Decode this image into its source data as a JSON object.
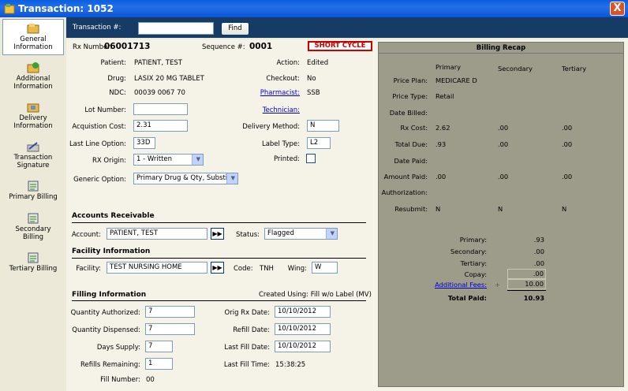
{
  "window": {
    "title": "Transaction: 1052",
    "close": "X"
  },
  "sidebar": [
    {
      "l1": "General",
      "l2": "Information"
    },
    {
      "l1": "Additional",
      "l2": "Information"
    },
    {
      "l1": "Delivery",
      "l2": "Information"
    },
    {
      "l1": "Transaction",
      "l2": "Signature"
    },
    {
      "l1": "Primary Billing",
      "l2": ""
    },
    {
      "l1": "Secondary",
      "l2": "Billing"
    },
    {
      "l1": "Tertiary Billing",
      "l2": ""
    }
  ],
  "search": {
    "label": "Transaction #:",
    "value": "",
    "find": "Find"
  },
  "rx": {
    "label": "Rx Number:",
    "value": "06001713",
    "seq_label": "Sequence #:",
    "seq_value": "0001",
    "short_cycle": "SHORT CYCLE"
  },
  "general": {
    "patient_l": "Patient:",
    "patient": "PATIENT, TEST",
    "drug_l": "Drug:",
    "drug": "LASIX 20 MG TABLET",
    "ndc_l": "NDC:",
    "ndc": "00039 0067 70",
    "lot_l": "Lot Number:",
    "lot": "",
    "acq_l": "Acquistion Cost:",
    "acq": "2.31",
    "llo_l": "Last Line Option:",
    "llo": "33D",
    "origin_l": "RX Origin:",
    "origin": "1 - Written",
    "generic_l": "Generic Option:",
    "generic": "Primary Drug & Qty, Substit",
    "action_l": "Action:",
    "action": "Edited",
    "checkout_l": "Checkout:",
    "checkout": "No",
    "pharm_l": "Pharmacist:",
    "pharm": "SSB",
    "tech_l": "Technician:",
    "delivery_l": "Delivery Method:",
    "delivery": "N",
    "labeltype_l": "Label Type:",
    "labeltype": "L2",
    "printed_l": "Printed:"
  },
  "ar": {
    "title": "Accounts Receivable",
    "account_l": "Account:",
    "account": "PATIENT, TEST",
    "status_l": "Status:",
    "status": "Flagged"
  },
  "facility": {
    "title": "Facility Information",
    "facility_l": "Facility:",
    "facility": "TEST NURSING HOME",
    "code_l": "Code:",
    "code": "TNH",
    "wing_l": "Wing:",
    "wing": "W"
  },
  "filling": {
    "title": "Filling Information",
    "created": "Created Using: Fill w/o Label (MV)",
    "qa_l": "Quantity Authorized:",
    "qa": "7",
    "qd_l": "Quantity Dispensed:",
    "qd": "7",
    "ds_l": "Days Supply:",
    "ds": "7",
    "rr_l": "Refills Remaining:",
    "rr": "1",
    "fn_l": "Fill Number:",
    "fn": "00",
    "orig_l": "Orig Rx Date:",
    "orig": "10/10/2012",
    "refill_l": "Refill Date:",
    "refill": "10/10/2012",
    "last_l": "Last Fill Date:",
    "last": "10/10/2012",
    "time_l": "Last Fill Time:",
    "time": "15:38:25"
  },
  "recap": {
    "title": "Billing Recap",
    "cols": [
      "Primary",
      "Secondary",
      "Tertiary"
    ],
    "price_plan_l": "Price Plan:",
    "price_plan": "MEDICARE D",
    "price_type_l": "Price Type:",
    "price_type": "Retail",
    "date_billed_l": "Date Billed:",
    "rx_cost_l": "Rx Cost:",
    "rx_cost": [
      "2.62",
      ".00",
      ".00"
    ],
    "total_due_l": "Total Due:",
    "total_due": [
      ".93",
      ".00",
      ".00"
    ],
    "date_paid_l": "Date Paid:",
    "amount_paid_l": "Amount Paid:",
    "amount_paid": [
      ".00",
      ".00",
      ".00"
    ],
    "auth_l": "Authorization:",
    "resubmit_l": "Resubmit:",
    "resubmit": [
      "N",
      "N",
      "N"
    ],
    "sum_primary_l": "Primary:",
    "sum_primary": ".93",
    "sum_secondary_l": "Secondary:",
    "sum_secondary": ".00",
    "sum_tertiary_l": "Tertiary:",
    "sum_tertiary": ".00",
    "copay_l": "Copay:",
    "copay": ".00",
    "fees_l": "Additional Fees:",
    "fees_plus": "+",
    "fees": "10.00",
    "total_paid_l": "Total Paid:",
    "total_paid": "10.93"
  }
}
